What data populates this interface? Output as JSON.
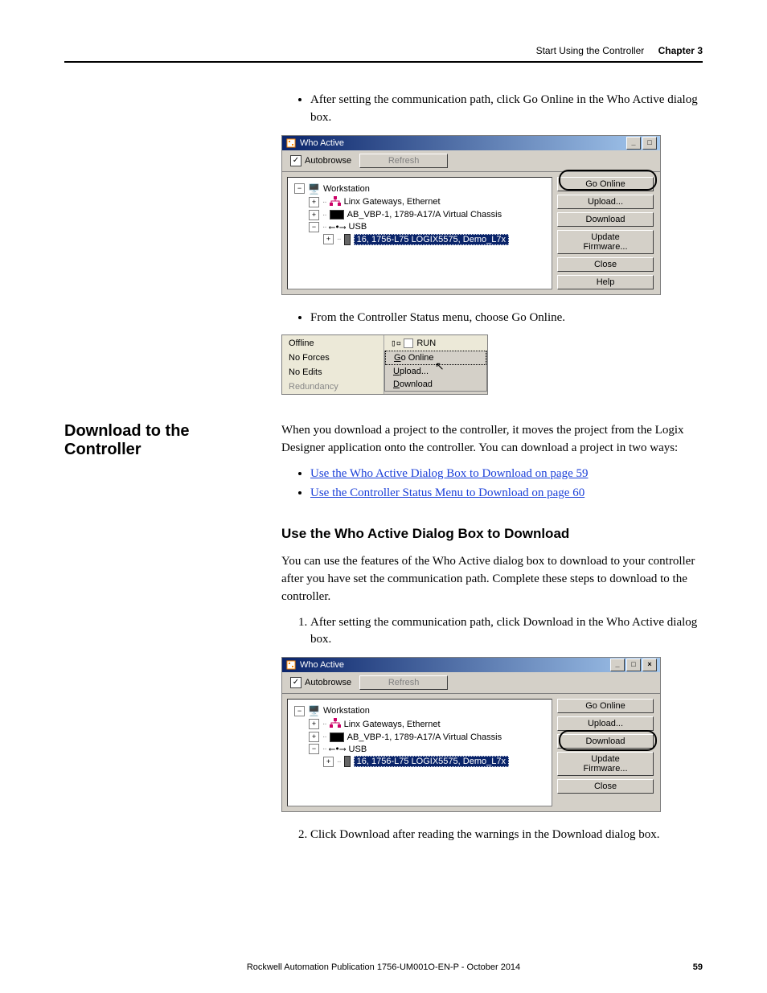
{
  "header": {
    "section": "Start Using the Controller",
    "chapter": "Chapter 3"
  },
  "body": {
    "bullet1": "After setting the communication path, click Go Online in the Who Active dialog box.",
    "bullet2": "From the Controller Status menu, choose Go Online."
  },
  "side_heading": "Download to the Controller",
  "download_intro": "When you download a project to the controller, it moves the project from the Logix Designer application onto the controller. You can download a project in two ways:",
  "download_links": {
    "a": "Use the Who Active Dialog Box to Download on page 59",
    "b": "Use the Controller Status Menu to Download on page 60"
  },
  "sub_heading": "Use the Who Active Dialog Box to Download",
  "sub_para": "You can use the features of the Who Active dialog box to download to your controller after you have set the communication path. Complete these steps to download to the controller.",
  "step1": "After setting the communication path, click Download in the Who Active dialog box.",
  "step2": "Click Download after reading the warnings in the Download dialog box.",
  "who_active": {
    "title": "Who Active",
    "autobrowse": "Autobrowse",
    "refresh": "Refresh",
    "tree": {
      "workstation": "Workstation",
      "linx": "Linx Gateways, Ethernet",
      "vbp": "AB_VBP-1, 1789-A17/A Virtual Chassis",
      "usb": "USB",
      "selected": "16, 1756-L75 LOGIX5575, Demo_L7x"
    },
    "buttons": {
      "go_online": "Go Online",
      "upload": "Upload...",
      "download": "Download",
      "update_fw": "Update Firmware...",
      "close": "Close",
      "help": "Help"
    }
  },
  "status_menu": {
    "offline": "Offline",
    "no_forces": "No Forces",
    "no_edits": "No Edits",
    "redundancy": "Redundancy",
    "run": "RUN",
    "go_online": "Go Online",
    "upload": "Upload...",
    "download": "Download"
  },
  "footer": {
    "text": "Rockwell Automation Publication 1756-UM001O-EN-P - October 2014",
    "page": "59"
  },
  "icon_names": {
    "app": "tree-app-icon",
    "pc": "workstation-icon",
    "net": "network-icon",
    "module": "module-icon",
    "usb": "usb-icon",
    "slot": "controller-slot-icon"
  }
}
